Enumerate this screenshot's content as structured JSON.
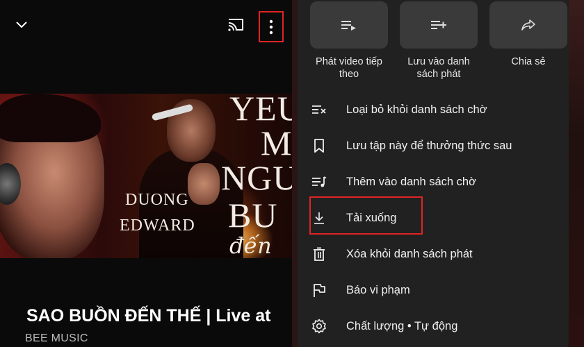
{
  "player": {
    "icons": [
      "chevron-down-icon",
      "cast-icon",
      "more-vertical-icon"
    ]
  },
  "thumbnail": {
    "text_yeu": "YEU",
    "text_m": "M",
    "text_ngu": "NGU",
    "text_bu": "BU",
    "text_duong": "DUONG",
    "text_edward": "EDWARD",
    "text_script": "đến"
  },
  "video": {
    "title": "SAO BUỒN ĐẾN THẾ | Live at",
    "channel": "BEE MUSIC"
  },
  "sheet": {
    "actions": [
      {
        "label": "Phát video tiếp theo",
        "icon": "play-next-icon"
      },
      {
        "label": "Lưu vào danh sách phát",
        "icon": "add-to-playlist-icon"
      },
      {
        "label": "Chia sẻ",
        "icon": "share-icon"
      }
    ],
    "menu": [
      {
        "label": "Loại bỏ khỏi danh sách chờ",
        "icon": "remove-from-queue-icon"
      },
      {
        "label": "Lưu tập này để thưởng thức sau",
        "icon": "bookmark-icon"
      },
      {
        "label": "Thêm vào danh sách chờ",
        "icon": "add-to-queue-icon"
      },
      {
        "label": "Tải xuống",
        "icon": "download-icon"
      },
      {
        "label": "Xóa khỏi danh sách phát",
        "icon": "trash-icon"
      },
      {
        "label": "Báo vi phạm",
        "icon": "flag-icon"
      },
      {
        "label": "Chất lượng • Tự động",
        "icon": "settings-icon"
      }
    ]
  },
  "colors": {
    "highlight": "#e02424",
    "sheet_bg": "#212121",
    "tile_bg": "#3a3a3a"
  }
}
